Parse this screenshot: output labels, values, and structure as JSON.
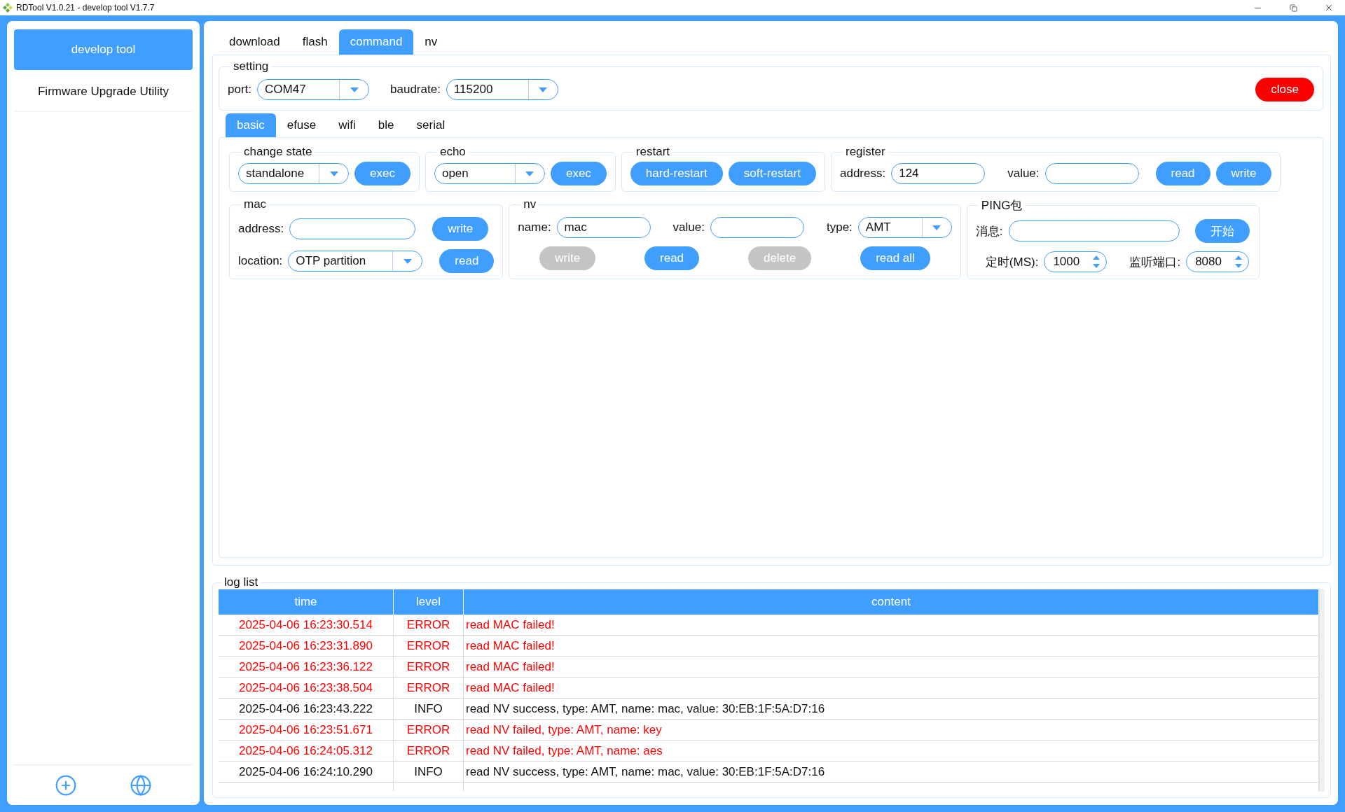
{
  "window": {
    "title": "RDTool V1.0.21 - develop tool V1.7.7"
  },
  "sidebar": {
    "items": [
      {
        "label": "develop tool",
        "selected": true
      },
      {
        "label": "Firmware Upgrade Utility",
        "selected": false
      }
    ]
  },
  "tabs": [
    {
      "label": "download",
      "selected": false
    },
    {
      "label": "flash",
      "selected": false
    },
    {
      "label": "command",
      "selected": true
    },
    {
      "label": "nv",
      "selected": false
    }
  ],
  "setting": {
    "legend": "setting",
    "port": {
      "label": "port:",
      "value": "COM47"
    },
    "baudrate": {
      "label": "baudrate:",
      "value": "115200"
    },
    "close_button": "close"
  },
  "subtabs": [
    {
      "label": "basic",
      "selected": true
    },
    {
      "label": "efuse",
      "selected": false
    },
    {
      "label": "wifi",
      "selected": false
    },
    {
      "label": "ble",
      "selected": false
    },
    {
      "label": "serial",
      "selected": false
    }
  ],
  "change_state": {
    "legend": "change state",
    "select": "standalone",
    "button": {
      "label": "exec",
      "disabled": false
    }
  },
  "echo": {
    "legend": "echo",
    "select": "open",
    "button": {
      "label": "exec",
      "disabled": false
    }
  },
  "restart": {
    "legend": "restart",
    "buttons": [
      {
        "label": "hard-restart",
        "disabled": false
      },
      {
        "label": "soft-restart",
        "disabled": false
      }
    ]
  },
  "register": {
    "legend": "register",
    "address": {
      "label": "address:",
      "value": "124"
    },
    "value": {
      "label": "value:"
    },
    "buttons": [
      {
        "label": "read",
        "disabled": false
      },
      {
        "label": "write",
        "disabled": false
      }
    ]
  },
  "mac": {
    "legend": "mac",
    "address": {
      "label": "address:"
    },
    "write_button": {
      "label": "write",
      "disabled": false
    },
    "location": {
      "label": "location:",
      "value": "OTP partition"
    },
    "read_button": {
      "label": "read",
      "disabled": false
    }
  },
  "nv": {
    "legend": "nv",
    "name": {
      "label": "name:",
      "value": "mac"
    },
    "value": {
      "label": "value:"
    },
    "type": {
      "label": "type:",
      "value": "AMT"
    },
    "buttons": [
      {
        "label": "write",
        "disabled": true
      },
      {
        "label": "read",
        "disabled": false
      },
      {
        "label": "delete",
        "disabled": true
      },
      {
        "label": "read all",
        "disabled": false
      }
    ]
  },
  "ping": {
    "legend": "PING包",
    "message": {
      "label": "消息:"
    },
    "start_button": {
      "label": "开始",
      "disabled": false
    },
    "timer": {
      "label": "定时(MS):",
      "value": "1000"
    },
    "port": {
      "label": "监听端口:",
      "value": "8080"
    }
  },
  "log": {
    "legend": "log list",
    "columns": [
      "time",
      "level",
      "content"
    ],
    "rows": [
      {
        "time": "2025-04-06 16:23:30.514",
        "level": "ERROR",
        "content": "read MAC failed!",
        "kind": "error"
      },
      {
        "time": "2025-04-06 16:23:31.890",
        "level": "ERROR",
        "content": "read MAC failed!",
        "kind": "error"
      },
      {
        "time": "2025-04-06 16:23:36.122",
        "level": "ERROR",
        "content": "read MAC failed!",
        "kind": "error"
      },
      {
        "time": "2025-04-06 16:23:38.504",
        "level": "ERROR",
        "content": "read MAC failed!",
        "kind": "error"
      },
      {
        "time": "2025-04-06 16:23:43.222",
        "level": "INFO",
        "content": "read NV success, type: AMT, name: mac, value: 30:EB:1F:5A:D7:16",
        "kind": "info"
      },
      {
        "time": "2025-04-06 16:23:51.671",
        "level": "ERROR",
        "content": "read NV failed, type: AMT, name: key",
        "kind": "error"
      },
      {
        "time": "2025-04-06 16:24:05.312",
        "level": "ERROR",
        "content": "read NV failed, type: AMT, name: aes",
        "kind": "error"
      },
      {
        "time": "2025-04-06 16:24:10.290",
        "level": "INFO",
        "content": "read NV success, type: AMT, name: mac, value: 30:EB:1F:5A:D7:16",
        "kind": "info"
      }
    ]
  }
}
